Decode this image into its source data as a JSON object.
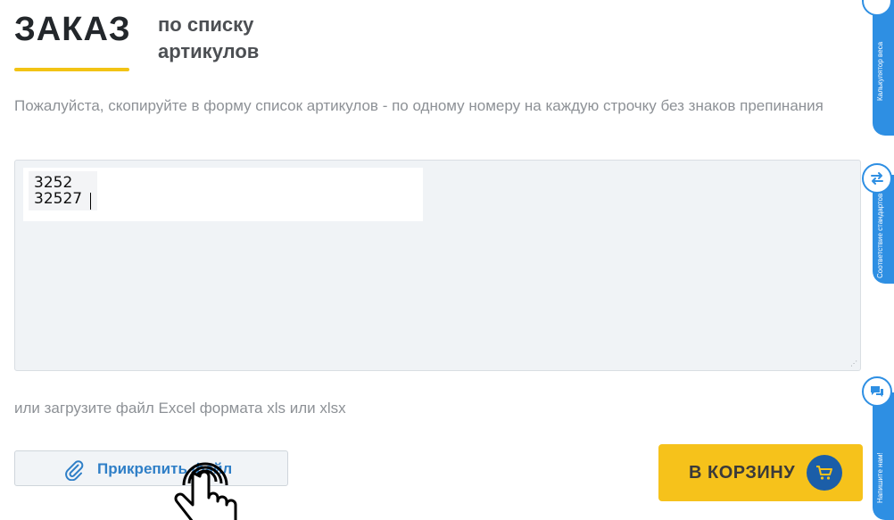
{
  "header": {
    "title": "ЗАКАЗ",
    "subtitle": "по списку артикулов"
  },
  "instructions": "Пожалуйста, скопируйте в форму список артикулов - по одному номеру на каждую строчку без знаков препинания",
  "textarea": {
    "line1": "3252",
    "line2": "32527"
  },
  "upload_text": "или загрузите файл Excel формата xls или xlsx",
  "attach_button": {
    "label": "Прикрепить файл",
    "icon": "paperclip-icon"
  },
  "cart_button": {
    "label": "В КОРЗИНУ",
    "icon": "cart-icon"
  },
  "side_tabs": [
    {
      "label": "Калькулятор веса"
    },
    {
      "label": "Соответствие стандартов",
      "icon": "arrows-swap-icon"
    },
    {
      "label": "Напишите нам!",
      "icon": "chat-icon"
    }
  ],
  "colors": {
    "accent_yellow": "#f6c21b",
    "accent_blue": "#2e8fe3",
    "cart_circle": "#1b5ea8",
    "link_blue": "#2f7fc7"
  }
}
